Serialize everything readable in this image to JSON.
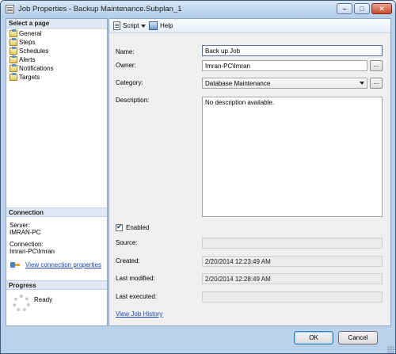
{
  "window": {
    "title": "Job Properties - Backup Maintenance.Subplan_1",
    "minimize_glyph": "–",
    "maximize_glyph": "□",
    "close_glyph": "✕"
  },
  "select_page": {
    "header": "Select a page",
    "items": [
      {
        "label": "General"
      },
      {
        "label": "Steps"
      },
      {
        "label": "Schedules"
      },
      {
        "label": "Alerts"
      },
      {
        "label": "Notifications"
      },
      {
        "label": "Targets"
      }
    ]
  },
  "connection": {
    "header": "Connection",
    "server_label": "Server:",
    "server_value": "IMRAN-PC",
    "connection_label": "Connection:",
    "connection_value": "Imran-PC\\Imran",
    "view_properties_link": "View connection properties"
  },
  "progress": {
    "header": "Progress",
    "status": "Ready"
  },
  "toolbar": {
    "script_label": "Script",
    "help_label": "Help"
  },
  "form": {
    "name_label": "Name:",
    "name_value": "Back up Job",
    "owner_label": "Owner:",
    "owner_value": "Imran-PC\\Imran",
    "owner_browse": "...",
    "category_label": "Category:",
    "category_value": "Database Maintenance",
    "category_browse": "...",
    "description_label": "Description:",
    "description_value": "No description available.",
    "enabled_label": "Enabled",
    "enabled_checked": true,
    "source_label": "Source:",
    "source_value": "",
    "created_label": "Created:",
    "created_value": "2/20/2014 12:23:49 AM",
    "modified_label": "Last modified:",
    "modified_value": "2/20/2014 12:28:49 AM",
    "executed_label": "Last executed:",
    "executed_value": "",
    "history_link": "View Job History"
  },
  "buttons": {
    "ok": "OK",
    "cancel": "Cancel"
  }
}
